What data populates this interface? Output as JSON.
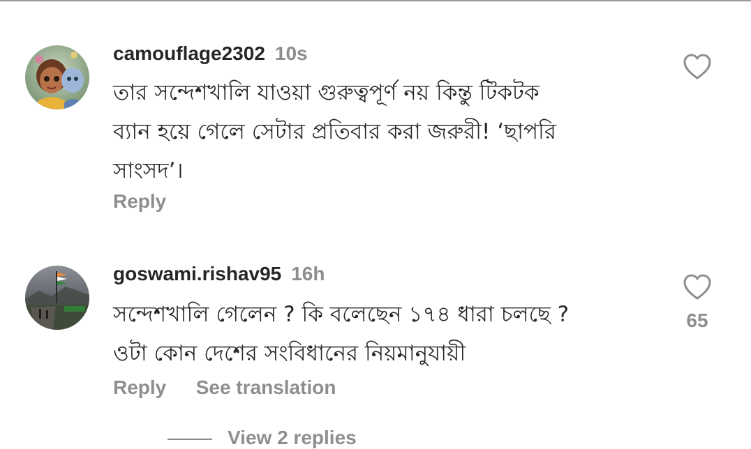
{
  "comments": [
    {
      "username": "camouflage2302",
      "time": "10s",
      "avatar_icon": "profile-avatar-illustration",
      "lines": [
        "তার সন্দেশখালি যাওয়া গুরুত্বপূর্ণ নয় কিন্তু টিকটক",
        "ব্যান হয়ে গেলে সেটার প্রতিবার করা জরুরী! ‘ছাপরি",
        "সাংসদ’।"
      ],
      "reply_label": "Reply",
      "like_icon": "heart-outline-icon",
      "like_count": ""
    },
    {
      "username": "goswami.rishav95",
      "time": "16h",
      "avatar_icon": "profile-avatar-photo",
      "lines": [
        "সন্দেশখালি গেলেন ? কি বলেছেন ১৭৪ ধারা চলছে ?",
        "ওটা কোন দেশের সংবিধানের নিয়মানুযায়ী"
      ],
      "reply_label": "Reply",
      "translate_label": "See translation",
      "like_icon": "heart-outline-icon",
      "like_count": "65"
    }
  ],
  "view_replies_label": "View 2 replies",
  "colors": {
    "text_primary": "#262626",
    "text_secondary": "#8e8e8e",
    "background": "#ffffff"
  }
}
